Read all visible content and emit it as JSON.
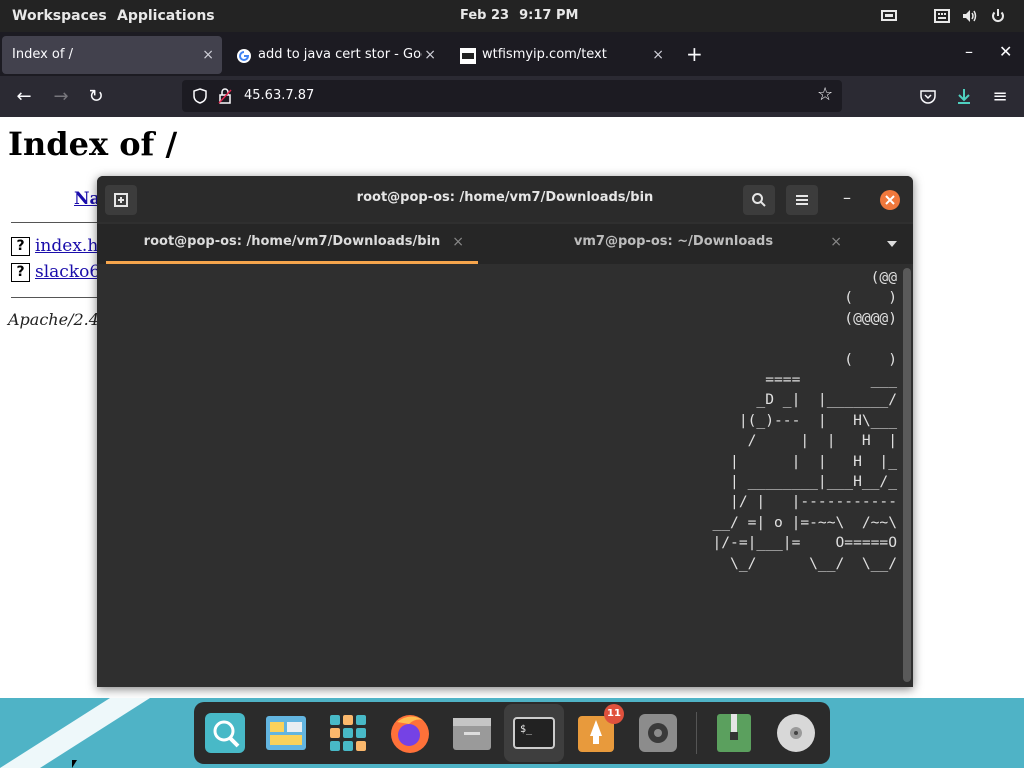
{
  "topbar": {
    "workspaces": "Workspaces",
    "applications": "Applications",
    "date": "Feb 23",
    "time": "9:17 PM"
  },
  "browser": {
    "tabs": [
      {
        "label": "Index of /",
        "close": "×"
      },
      {
        "label": "add to java cert stor - Goog",
        "close": "×",
        "favicon": "google-icon"
      },
      {
        "label": "wtfismyip.com/text",
        "close": "×",
        "favicon": "wtf-icon"
      }
    ],
    "new_tab": "+",
    "url": "45.63.7.87"
  },
  "page": {
    "title": "Index of /",
    "column_name": "Na",
    "files": [
      "index.ht",
      "slacko6"
    ],
    "file_icon": "?",
    "address": "Apache/2.4"
  },
  "terminal": {
    "title": "root@pop-os: /home/vm7/Downloads/bin",
    "tabs": [
      {
        "label": "root@pop-os: /home/vm7/Downloads/bin",
        "close": "×"
      },
      {
        "label": "vm7@pop-os: ~/Downloads",
        "close": "×"
      }
    ],
    "accent": "#f6a54c",
    "close_color": "#f0783c",
    "art_lines": [
      "  (@@",
      "(    )",
      "(@@@@)",
      "",
      "(    )",
      "====        ___",
      "_D _|  |_______/",
      " |(_)---  |   H\\___",
      " /     |  |   H  |",
      "|      |  |   H  |_",
      "| ________|___H__/_",
      "|/ |   |-----------",
      "__/ =| o |=-~~\\  /~~\\",
      " |/-=|___|=    O=====O",
      "  \\_/      \\__/  \\__/"
    ]
  },
  "dock": {
    "apps": [
      "search-app",
      "files-app",
      "app-grid",
      "firefox-app",
      "file-manager-app",
      "terminal-app",
      "launcher-app",
      "settings-app",
      "archive-app",
      "disc-app"
    ],
    "badge": "11"
  }
}
